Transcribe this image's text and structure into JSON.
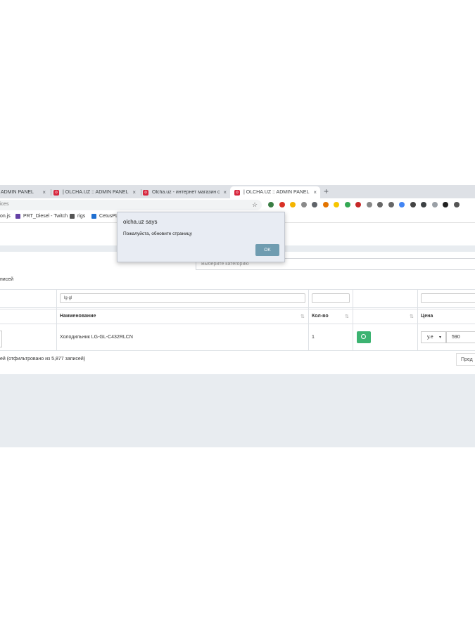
{
  "browser": {
    "tabs": [
      {
        "title": "ADMIN PANEL"
      },
      {
        "title": "| OLCHA.UZ :: ADMIN PANEL"
      },
      {
        "title": "Olcha.uz - интернет магазин с"
      },
      {
        "title": "| OLCHA.UZ :: ADMIN PANEL"
      }
    ],
    "tab_close_glyph": "×",
    "new_tab_glyph": "+",
    "address_fragment": "ices",
    "bookmarks": [
      {
        "label": "on.js",
        "icon": "page-icon"
      },
      {
        "label": "PRT_Diesel - Twitch",
        "icon": "twitch-icon"
      },
      {
        "label": "rigs",
        "icon": "folder-icon"
      },
      {
        "label": "CetusPL",
        "icon": "cetus-icon"
      }
    ],
    "extension_colors": [
      "#3a7d44",
      "#d93025",
      "#f4b400",
      "#8a8a8a",
      "#5f6368",
      "#e37400",
      "#f7c600",
      "#34a853",
      "#c62828",
      "#888888",
      "#666666",
      "#666666",
      "#4285f4",
      "#444444",
      "#3c4043",
      "#9aa0a6",
      "#222222",
      "#555555"
    ]
  },
  "dialog": {
    "title": "olcha.uz says",
    "message": "Пожалуйста, обновите страницу",
    "ok_label": "OK"
  },
  "page": {
    "category_placeholder": "Выберите категорию",
    "records_label": "писей",
    "filter_name_value": "lg-gl",
    "table": {
      "headers": {
        "name": "Наименование",
        "qty": "Кол-во",
        "price": "Цена"
      },
      "row": {
        "name": "Холодильник LG-GL-C432RLCN",
        "qty": "1",
        "currency": "у.е",
        "price": "590"
      }
    },
    "footer_info": "ей (отфильтровано из 5,877 записей)",
    "prev_label": "Пред"
  },
  "colors": {
    "tab_favicon": "#d7263d",
    "action_button": "#3cb371",
    "dialog_ok": "#6f9cb0",
    "gray_area": "#e8ecf0"
  }
}
